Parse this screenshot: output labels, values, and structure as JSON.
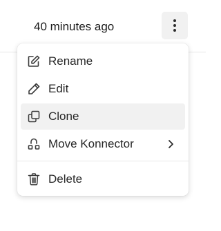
{
  "row": {
    "timestamp": "40 minutes ago",
    "more_button_icon": "more-vertical-icon"
  },
  "menu": {
    "items": [
      {
        "label": "Rename",
        "icon": "rename-icon"
      },
      {
        "label": "Edit",
        "icon": "pencil-icon"
      },
      {
        "label": "Clone",
        "icon": "clone-icon",
        "hovered": true
      },
      {
        "label": "Move Konnector",
        "icon": "move-icon",
        "submenu_icon": "chevron-right-icon"
      },
      {
        "label": "Delete",
        "icon": "trash-icon"
      }
    ]
  },
  "colors": {
    "hover_background": "#f1f1f1",
    "button_background": "#f1f1f1",
    "divider": "#e6e6e6",
    "text": "#262626",
    "icon": "#3a3a3a"
  }
}
